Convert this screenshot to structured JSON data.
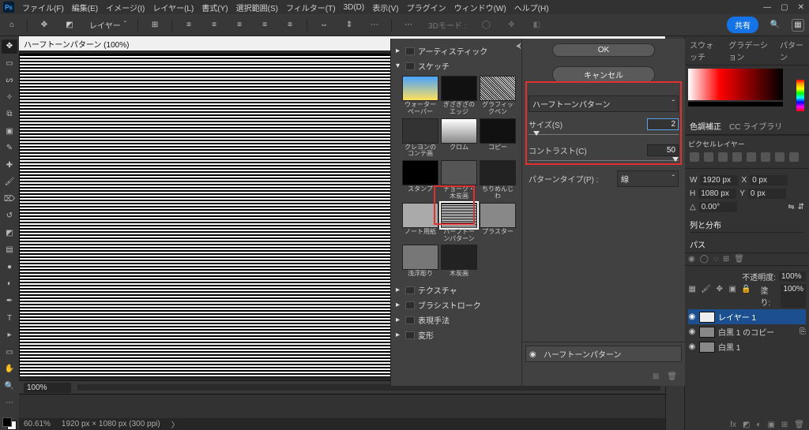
{
  "app_icon": "Ps",
  "menu": [
    "ファイル(F)",
    "編集(E)",
    "イメージ(I)",
    "レイヤー(L)",
    "書式(Y)",
    "選択範囲(S)",
    "フィルター(T)",
    "3D(D)",
    "表示(V)",
    "プラグイン",
    "ウィンドウ(W)",
    "ヘルプ(H)"
  ],
  "options_bar": {
    "layer_dd": "レイヤー",
    "mode_dd": "3Dモード :",
    "share": "共有"
  },
  "document": {
    "tab": "ハーフトーンパターン (100%)",
    "zoom": "100%"
  },
  "filter_gallery": {
    "categories": {
      "artistic": "アーティスティック",
      "sketch": "スケッチ",
      "texture": "テクスチャ",
      "brushstrokes": "ブラシストローク",
      "stylize": "表現手法",
      "distort": "変形"
    },
    "sketch_thumbs": [
      "ウォーターペーパー",
      "ぎざぎざのエッジ",
      "グラフィックペン",
      "クレヨンのコンテ画",
      "クロム",
      "コピー",
      "スタンプ",
      "チョーク・木炭画",
      "ちりめんじわ",
      "ノート用紙",
      "ハーフトーンパターン",
      "プラスター",
      "浅浮彫り",
      "木炭画"
    ],
    "ok": "OK",
    "cancel": "キャンセル",
    "type_dd": "ハーフトーンパターン",
    "params": {
      "size_label": "サイズ(S)",
      "size_value": "2",
      "contrast_label": "コントラスト(C)",
      "contrast_value": "50",
      "pattern_label": "パターンタイプ(P) :",
      "pattern_value": "線"
    },
    "effect_stack_item": "ハーフトーンパターン"
  },
  "right": {
    "tabs_color": [
      "スウォッチ",
      "グラデーション",
      "パターン"
    ],
    "tabs_adjust": [
      "色調補正",
      "CC ライブラリ"
    ],
    "adjust_label": "ピクセルレイヤー",
    "prop_tabs": [
      "列と分布"
    ],
    "props": {
      "w_label": "W",
      "w": "1920 px",
      "x_label": "X",
      "x": "0 px",
      "h_label": "H",
      "h": "1080 px",
      "y_label": "Y",
      "y": "0 px",
      "angle_label": "△",
      "angle": "0.00°"
    },
    "path_tab": "パス",
    "paths_opacity_label": "不透明度:",
    "paths_opacity": "100%",
    "fill_label": "塗り:",
    "fill_value": "100%",
    "layers": [
      {
        "name": "レイヤー 1",
        "visible": true,
        "active": true
      },
      {
        "name": "白黒 1 のコピー",
        "visible": true,
        "active": false
      },
      {
        "name": "白黒 1",
        "visible": true,
        "active": false
      }
    ]
  },
  "status": {
    "zoom": "60.61%",
    "dims": "1920 px × 1080 px (300 ppi)"
  },
  "chart_data": null
}
